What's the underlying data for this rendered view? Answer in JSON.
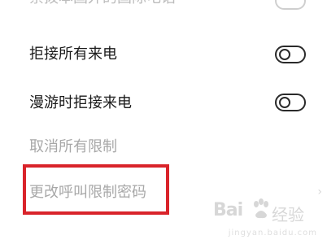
{
  "settings": {
    "cut_off_item": {
      "label": "禁拨本国外的国际电话"
    },
    "items": [
      {
        "label": "拒接所有来电",
        "toggle": "off"
      },
      {
        "label": "漫游时拒接来电",
        "toggle": "off"
      }
    ],
    "cancel_all": {
      "label": "取消所有限制"
    },
    "change_password": {
      "label": "更改呼叫限制密码"
    }
  },
  "colors": {
    "highlight": "#d9232a",
    "disabled_text": "#a8a8a8"
  },
  "watermark": {
    "brand": "Bai",
    "product": "经验",
    "url": "jingyan.baidu.com"
  }
}
